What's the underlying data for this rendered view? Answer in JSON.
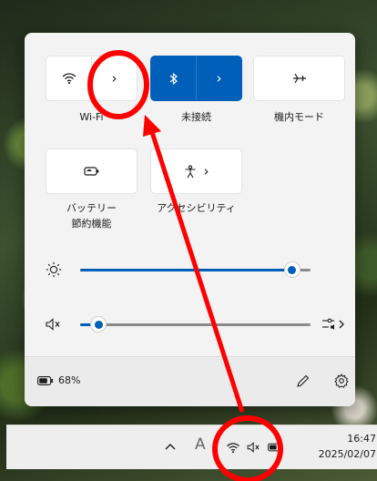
{
  "quick_settings": {
    "tiles": [
      {
        "label": "Wi-Fi",
        "icon": "wifi-icon",
        "state": "off",
        "has_expand": true
      },
      {
        "label": "未接続",
        "icon": "bluetooth-icon",
        "state": "on",
        "has_expand": true
      },
      {
        "label": "機内モード",
        "icon": "airplane-icon",
        "state": "off",
        "has_expand": false
      },
      {
        "label": "バッテリー\n節約機能",
        "icon": "battery-saver-icon",
        "state": "off",
        "has_expand": false
      },
      {
        "label": "アクセシビリティ",
        "icon": "accessibility-icon",
        "state": "off",
        "has_expand": true
      }
    ],
    "brightness": {
      "icon": "brightness-icon",
      "level": 0.92
    },
    "volume": {
      "icon": "speaker-muted-icon",
      "level": 0.08,
      "muted": true,
      "end_icon": "audio-output-icon"
    },
    "footer": {
      "battery_icon": "battery-icon",
      "battery_percent": "68%",
      "edit_icon": "pencil-icon",
      "settings_icon": "gear-icon"
    }
  },
  "taskbar": {
    "chevron_icon": "chevron-up-icon",
    "input_indicator": "A",
    "tray_icons": [
      "wifi-icon",
      "speaker-muted-icon",
      "battery-icon"
    ],
    "time": "16:47",
    "date": "2025/02/07"
  },
  "colors": {
    "accent": "#005fb8",
    "annotation": "#ff0000"
  }
}
